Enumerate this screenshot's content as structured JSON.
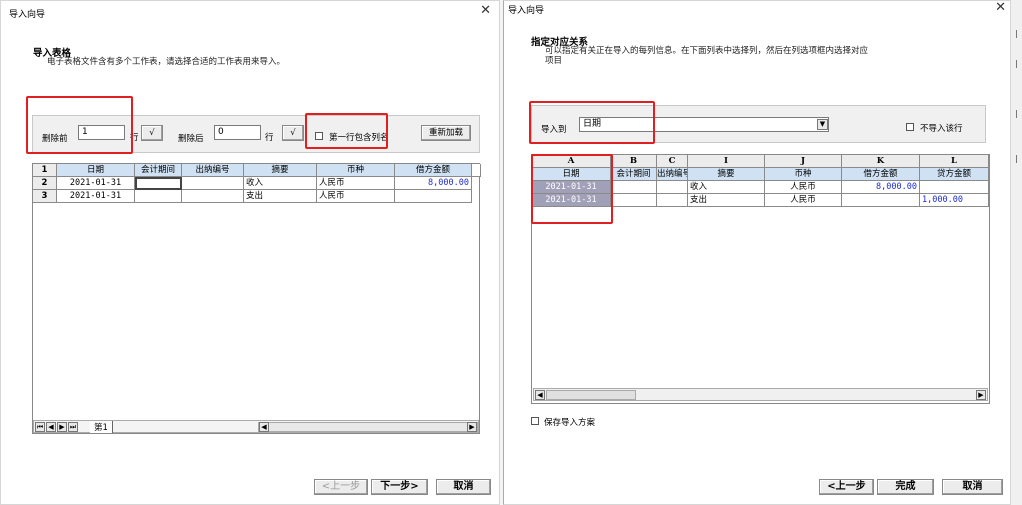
{
  "wizard1": {
    "title": "导入向导",
    "heading": "导入表格",
    "desc": "电子表格文件含有多个工作表，请选择合适的工作表用来导入。",
    "delete_before_label": "删除前",
    "delete_before_value": "1",
    "row_unit": "行",
    "confirm": "√",
    "delete_after_label": "删除后",
    "delete_after_value": "0",
    "first_row_header_label": "第一行包含列名",
    "reload_label": "重新加载",
    "table": {
      "row_numbers": [
        "1",
        "2",
        "3"
      ],
      "headers": [
        "日期",
        "会计期间",
        "出纳编号",
        "摘要",
        "币种",
        "借方金额"
      ],
      "rows": [
        [
          "2021-01-31",
          "",
          "",
          "收入",
          "人民币",
          "8,000.00"
        ],
        [
          "2021-01-31",
          "",
          "",
          "支出",
          "人民币",
          ""
        ]
      ]
    },
    "sheet_tab": "第1",
    "prev_label": "<上一步",
    "next_label": "下一步>",
    "cancel_label": "取消"
  },
  "wizard2": {
    "title": "导入向导",
    "heading": "指定对应关系",
    "desc_line1": "可以指定有关正在导入的每列信息。在下面列表中选择列，然后在列选项框内选择对应",
    "desc_line2": "项目",
    "import_to_label": "导入到",
    "import_to_value": "日期",
    "no_import_label": "不导入该行",
    "table": {
      "letters": [
        "A",
        "B",
        "C",
        "I",
        "J",
        "K",
        "L"
      ],
      "headers": [
        "日期",
        "会计期间",
        "出纳编号",
        "摘要",
        "币种",
        "借方金额",
        "贷方金额"
      ],
      "rows": [
        [
          "2021-01-31",
          "",
          "",
          "收入",
          "人民币",
          "8,000.00",
          ""
        ],
        [
          "2021-01-31",
          "",
          "",
          "支出",
          "人民币",
          "",
          "1,000.00"
        ]
      ]
    },
    "save_scheme_label": "保存导入方案",
    "prev_label": "<上一步",
    "finish_label": "完成",
    "cancel_label": "取消"
  },
  "colors": {
    "highlight_red": "#e02020",
    "header_blue": "#cfe1f3",
    "amount_blue": "#1c2bd4",
    "selected_col": "#a0a0b8"
  }
}
